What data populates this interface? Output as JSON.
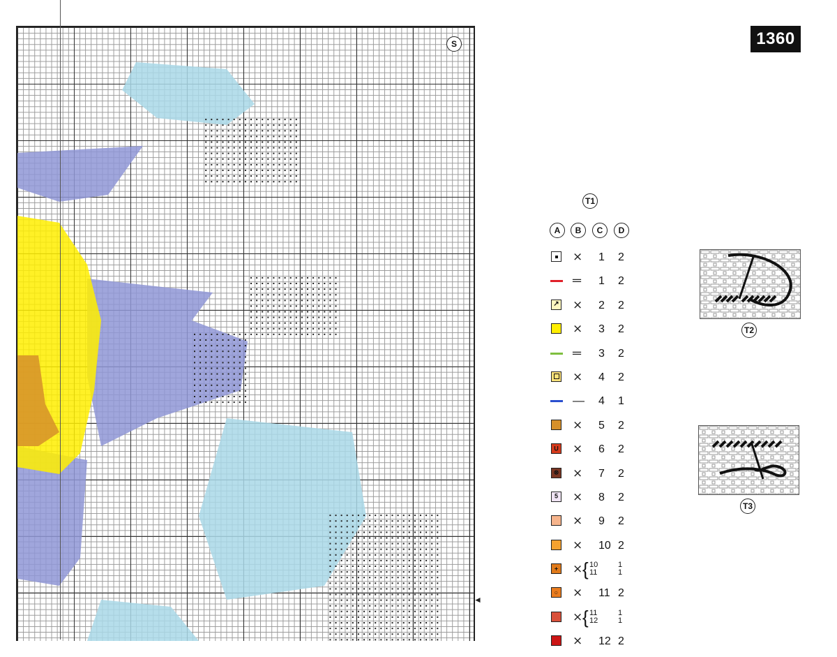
{
  "page": {
    "number": "1360",
    "section_mark": "S"
  },
  "legend": {
    "table_mark": "T1",
    "headers": [
      "A",
      "B",
      "C",
      "D"
    ],
    "rows": [
      {
        "symbol": "dot",
        "fill": "#ffffff",
        "glyph": "",
        "stitch": "cross",
        "c": "1",
        "d": "2"
      },
      {
        "symbol": "line",
        "fill": "#e0202a",
        "glyph": "",
        "stitch": "backstitch",
        "c": "1",
        "d": "2"
      },
      {
        "symbol": "diag",
        "fill": "#fff8c0",
        "glyph": "",
        "stitch": "cross",
        "c": "2",
        "d": "2"
      },
      {
        "symbol": "solid",
        "fill": "#ffee00",
        "glyph": "",
        "stitch": "cross",
        "c": "3",
        "d": "2"
      },
      {
        "symbol": "line",
        "fill": "#7fbf3f",
        "glyph": "",
        "stitch": "backstitch",
        "c": "3",
        "d": "2"
      },
      {
        "symbol": "square",
        "fill": "#ffe27a",
        "glyph": "",
        "stitch": "cross",
        "c": "4",
        "d": "2"
      },
      {
        "symbol": "line",
        "fill": "#2a4fcf",
        "glyph": "",
        "stitch": "single",
        "c": "4",
        "d": "1"
      },
      {
        "symbol": "solid",
        "fill": "#d6902a",
        "glyph": "",
        "stitch": "cross",
        "c": "5",
        "d": "2"
      },
      {
        "symbol": "glyph",
        "fill": "#d63a1c",
        "glyph": "U",
        "stitch": "cross",
        "c": "6",
        "d": "2"
      },
      {
        "symbol": "glyph",
        "fill": "#7a3522",
        "glyph": "⊗",
        "stitch": "cross",
        "c": "7",
        "d": "2"
      },
      {
        "symbol": "glyph",
        "fill": "#f0e4f4",
        "glyph": "5",
        "stitch": "cross",
        "c": "8",
        "d": "2"
      },
      {
        "symbol": "solid",
        "fill": "#f6b48c",
        "glyph": "",
        "stitch": "cross",
        "c": "9",
        "d": "2"
      },
      {
        "symbol": "solid",
        "fill": "#f5a230",
        "glyph": "",
        "stitch": "cross",
        "c": "10",
        "d": "2"
      },
      {
        "symbol": "glyph",
        "fill": "#e07a1a",
        "glyph": "+",
        "stitch": "cross-blend",
        "c": [
          "10",
          "11"
        ],
        "d": [
          "1",
          "1"
        ]
      },
      {
        "symbol": "glyph",
        "fill": "#ea7c1e",
        "glyph": "○",
        "stitch": "cross",
        "c": "11",
        "d": "2"
      },
      {
        "symbol": "solid",
        "fill": "#d9503a",
        "glyph": "",
        "stitch": "cross-blend",
        "c": [
          "11",
          "12"
        ],
        "d": [
          "1",
          "1"
        ]
      },
      {
        "symbol": "solid",
        "fill": "#cc1515",
        "glyph": "",
        "stitch": "cross",
        "c": "12",
        "d": "2"
      }
    ]
  },
  "diagrams": [
    {
      "label": "T2",
      "icon": "needle-stitch-diagram"
    },
    {
      "label": "T3",
      "icon": "needle-stitch-diagram"
    }
  ],
  "colors": {
    "blue_fill": "#8f96d6",
    "light_blue_fill": "#a9d8e8",
    "yellow_fill": "#ffee00",
    "orange_fill": "#d6902a"
  }
}
